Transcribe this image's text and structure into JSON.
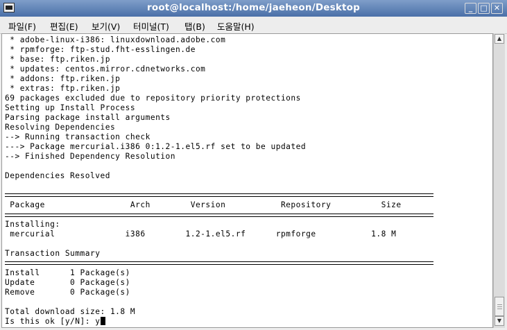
{
  "window": {
    "title": "root@localhost:/home/jaeheon/Desktop",
    "buttons": {
      "minimize": "_",
      "maximize": "□",
      "close": "✕"
    }
  },
  "menu": [
    "파일(F)",
    "편집(E)",
    "보기(V)",
    "터미널(T)",
    "탭(B)",
    "도움말(H)"
  ],
  "terminal": {
    "lines": [
      " * adobe-linux-i386: linuxdownload.adobe.com",
      " * rpmforge: ftp-stud.fht-esslingen.de",
      " * base: ftp.riken.jp",
      " * updates: centos.mirror.cdnetworks.com",
      " * addons: ftp.riken.jp",
      " * extras: ftp.riken.jp",
      "69 packages excluded due to repository priority protections",
      "Setting up Install Process",
      "Parsing package install arguments",
      "Resolving Dependencies",
      "--> Running transaction check",
      "---> Package mercurial.i386 0:1.2-1.el5.rf set to be updated",
      "--> Finished Dependency Resolution",
      "",
      "Dependencies Resolved",
      "",
      "",
      " Package                 Arch        Version           Repository          Size",
      "",
      "Installing:",
      " mercurial              i386        1.2-1.el5.rf      rpmforge           1.8 M",
      "",
      "Transaction Summary",
      "",
      "Install      1 Package(s)",
      "Update       0 Package(s)",
      "Remove       0 Package(s)",
      "",
      "Total download size: 1.8 M"
    ],
    "prompt": "Is this ok [y/N]: ",
    "input_value": "y"
  }
}
